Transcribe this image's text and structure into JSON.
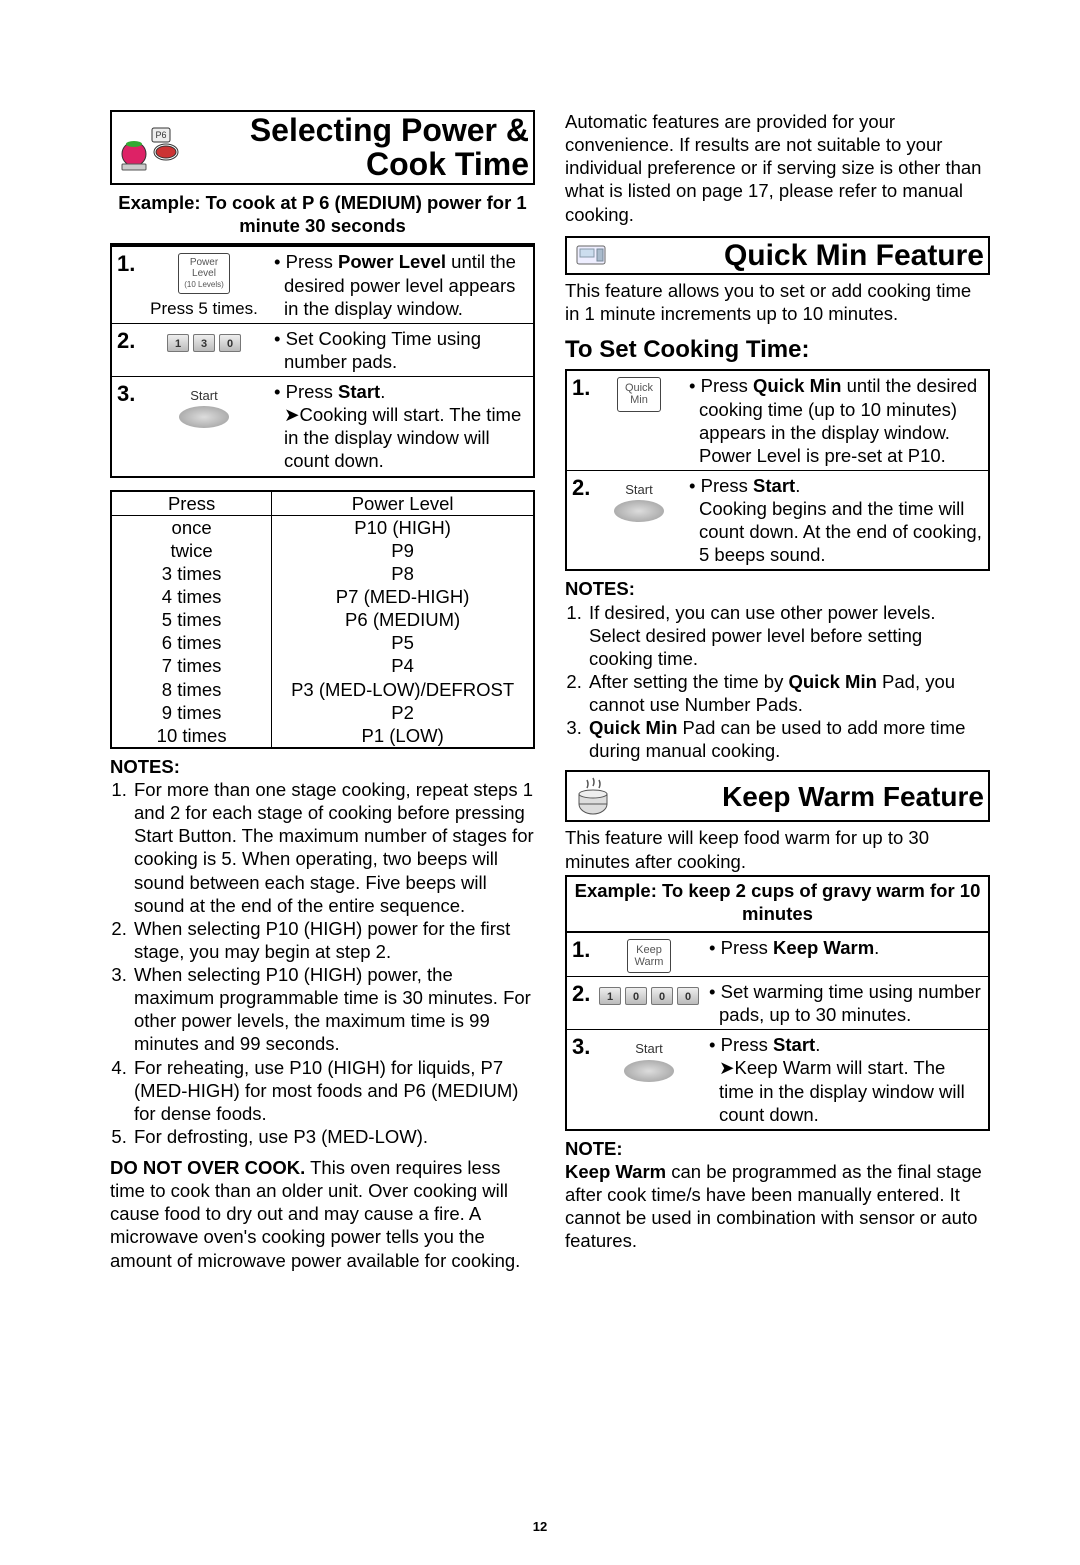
{
  "page_number": "12",
  "left": {
    "section_title": "Selecting Power & Cook Time",
    "example_caption": "Example: To cook at P 6 (MEDIUM) power for 1 minute 30 seconds",
    "steps": [
      {
        "num": "1.",
        "btn_line1": "Power",
        "btn_line2": "Level",
        "btn_line3": "(10 Levels)",
        "graphic_caption": "Press 5 times.",
        "desc_bullet_prefix": "• Press ",
        "desc_bold": "Power Level",
        "desc_after": " until the desired power level appears in the display window."
      },
      {
        "num": "2.",
        "pads": [
          "1",
          "3",
          "0"
        ],
        "desc_full": "• Set Cooking Time using number pads."
      },
      {
        "num": "3.",
        "start_label": "Start",
        "desc_l1_prefix": "• Press ",
        "desc_l1_bold": "Start",
        "desc_l1_after": ".",
        "desc_l2_prefix": "➤",
        "desc_l2": "Cooking will start. The time in the display window will count down."
      }
    ],
    "power_table": {
      "headers": [
        "Press",
        "Power Level"
      ],
      "rows": [
        [
          "once",
          "P10 (HIGH)"
        ],
        [
          "twice",
          "P9"
        ],
        [
          "3 times",
          "P8"
        ],
        [
          "4 times",
          "P7 (MED-HIGH)"
        ],
        [
          "5 times",
          "P6 (MEDIUM)"
        ],
        [
          "6 times",
          "P5"
        ],
        [
          "7 times",
          "P4"
        ],
        [
          "8 times",
          "P3 (MED-LOW)/DEFROST"
        ],
        [
          "9 times",
          "P2"
        ],
        [
          "10 times",
          "P1 (LOW)"
        ]
      ]
    },
    "notes_header": "NOTES:",
    "notes": [
      "For more than one stage cooking, repeat steps 1 and 2 for each stage of cooking before pressing Start Button. The maximum number of stages for cooking is 5. When operating, two beeps will sound between each stage. Five beeps will sound at the end of the entire sequence.",
      "When selecting P10 (HIGH) power for the first stage, you may begin at step 2.",
      "When selecting P10 (HIGH) power, the maximum programmable time is 30 minutes. For other power levels, the maximum time is 99 minutes and 99 seconds.",
      "For reheating, use P10 (HIGH) for liquids, P7 (MED-HIGH) for most foods and P6 (MEDIUM) for dense foods.",
      "For defrosting, use P3 (MED-LOW)."
    ],
    "warning_bold": "DO NOT OVER COOK.",
    "warning_rest": " This oven requires less time to cook than an older unit. Over cooking will cause food to dry out and may cause a fire. A microwave oven's cooking power tells you the amount of microwave power available for cooking."
  },
  "right": {
    "intro": "Automatic features are provided for your convenience. If results are not suitable to your individual preference or if serving size is other than what is listed on page 17, please refer to manual cooking.",
    "quick_title": "Quick Min Feature",
    "quick_intro": "This feature allows you to set or add cooking time in 1 minute increments up to 10 minutes.",
    "quick_subhead": "To Set Cooking Time:",
    "quick_steps": [
      {
        "num": "1.",
        "btn_l1": "Quick",
        "btn_l2": "Min",
        "desc_prefix": "• Press ",
        "desc_bold": "Quick Min",
        "desc_after": " until the desired cooking time (up to 10 minutes) appears in the display window. Power Level is pre-set at P10."
      },
      {
        "num": "2.",
        "start_label": "Start",
        "desc_l1_prefix": "• Press ",
        "desc_l1_bold": "Start",
        "desc_l1_after": ".",
        "desc_l2": "Cooking begins and the time will count down. At the end of cooking, 5 beeps sound."
      }
    ],
    "quick_notes_header": "NOTES:",
    "quick_notes": [
      {
        "text": "If desired, you can use other power levels. Select desired power level before setting cooking time."
      },
      {
        "pre": "After setting the time by ",
        "bold": "Quick Min",
        "post": " Pad, you cannot use Number Pads."
      },
      {
        "bold_first": "Quick Min",
        "post": " Pad can be used to add more time during manual cooking."
      }
    ],
    "warm_title": "Keep Warm Feature",
    "warm_intro": "This feature will keep food warm for up to 30 minutes after cooking.",
    "warm_example": "Example: To keep 2 cups of gravy warm for 10 minutes",
    "warm_steps": [
      {
        "num": "1.",
        "btn_l1": "Keep",
        "btn_l2": "Warm",
        "desc_prefix": "• Press ",
        "desc_bold": "Keep Warm",
        "desc_after": "."
      },
      {
        "num": "2.",
        "pads": [
          "1",
          "0",
          "0",
          "0"
        ],
        "desc_full": "• Set warming time using number pads, up to 30 minutes."
      },
      {
        "num": "3.",
        "start_label": "Start",
        "desc_l1_prefix": "• Press ",
        "desc_l1_bold": "Start",
        "desc_l1_after": ".",
        "desc_l2_prefix": "➤",
        "desc_l2": "Keep Warm will start. The time in the display window will count down."
      }
    ],
    "warm_note_header": "NOTE:",
    "warm_note_bold": "Keep Warm",
    "warm_note_rest": " can be programmed as the final stage after cook time/s have been manually entered. It cannot be used in combination with sensor or auto features."
  }
}
